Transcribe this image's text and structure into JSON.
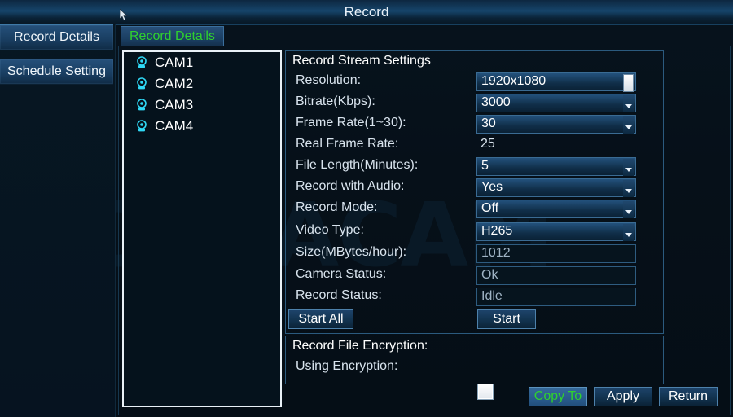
{
  "window": {
    "title": "Record",
    "watermark": "POMIACAM"
  },
  "sidebar": {
    "items": [
      {
        "label": "Record Details"
      },
      {
        "label": "Schedule Setting"
      }
    ]
  },
  "tabs": [
    {
      "label": "Record Details"
    }
  ],
  "camera_list": {
    "items": [
      {
        "label": "CAM1",
        "icon": "camera-icon"
      },
      {
        "label": "CAM2",
        "icon": "camera-icon"
      },
      {
        "label": "CAM3",
        "icon": "camera-icon"
      },
      {
        "label": "CAM4",
        "icon": "camera-icon"
      }
    ]
  },
  "stream_settings": {
    "title": "Record Stream Settings",
    "fields": [
      {
        "label": "Resolution:",
        "value": "1920x1080",
        "control": "dropdown-scroll"
      },
      {
        "label": "Bitrate(Kbps):",
        "value": "3000",
        "control": "dropdown"
      },
      {
        "label": "Frame Rate(1~30):",
        "value": "30",
        "control": "dropdown"
      },
      {
        "label": "Real Frame Rate:",
        "value": "25",
        "control": "text"
      },
      {
        "label": "File Length(Minutes):",
        "value": "5",
        "control": "dropdown"
      },
      {
        "label": "Record with Audio:",
        "value": "Yes",
        "control": "dropdown"
      },
      {
        "label": "Record Mode:",
        "value": "Off",
        "control": "dropdown"
      },
      {
        "label": "Video Type:",
        "value": "H265",
        "control": "dropdown"
      },
      {
        "label": "Size(MBytes/hour):",
        "value": "1012",
        "control": "readonly"
      },
      {
        "label": "Camera Status:",
        "value": "Ok",
        "control": "readonly"
      },
      {
        "label": "Record Status:",
        "value": "Idle",
        "control": "readonly"
      }
    ],
    "start_all_label": "Start All",
    "start_label": "Start"
  },
  "encryption": {
    "title": "Record File Encryption:",
    "checkbox_label": "Using Encryption:",
    "checked": false
  },
  "footer": {
    "copy_to_label": "Copy To",
    "apply_label": "Apply",
    "return_label": "Return"
  },
  "colors": {
    "accent_green": "#2fd12f",
    "cam_icon_cyan": "#2fd8f5",
    "panel_border": "#2b5a7e",
    "field_border": "#3a6b93"
  }
}
